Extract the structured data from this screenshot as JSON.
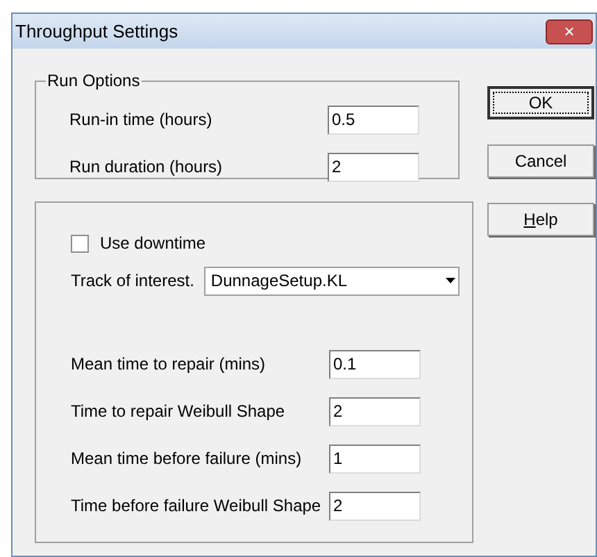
{
  "window": {
    "title": "Throughput Settings",
    "close": "×"
  },
  "run_options": {
    "legend": "Run Options",
    "fields": [
      {
        "label": "Run-in time (hours)",
        "value": "0.5"
      },
      {
        "label": "Run duration (hours)",
        "value": "2"
      }
    ]
  },
  "buttons": [
    {
      "label": "OK",
      "default": true
    },
    {
      "label": "Cancel",
      "default": false
    },
    {
      "label": "Help",
      "default": false
    }
  ],
  "downtime": {
    "checkbox": {
      "label": "Use downtime",
      "checked": false
    },
    "track": {
      "label": "Track of interest.",
      "value": "DunnageSetup.KL"
    },
    "fields": [
      {
        "label": "Mean time to repair (mins)",
        "value": "0.1"
      },
      {
        "label": "Time to repair Weibull Shape",
        "value": "2"
      },
      {
        "label": "Mean time before failure (mins)",
        "value": "1"
      },
      {
        "label": "Time before failure Weibull Shape",
        "value": "2"
      }
    ]
  }
}
